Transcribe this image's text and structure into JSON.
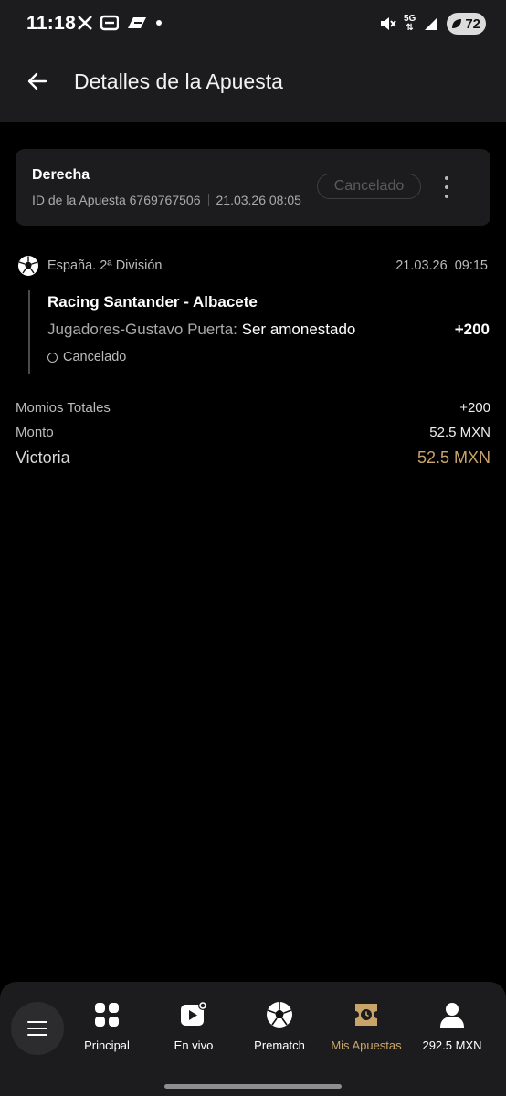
{
  "status_bar": {
    "time": "11:18",
    "network": "5G",
    "battery": "72",
    "colors": {
      "battery_bg": "#dcdcdc"
    }
  },
  "header": {
    "title": "Detalles de la Apuesta"
  },
  "bet": {
    "type": "Derecha",
    "id_label": "ID de la Apuesta 6769767506",
    "placed_at": "21.03.26 08:05",
    "status": "Cancelado"
  },
  "event": {
    "league": "España. 2ª División",
    "datetime": "21.03.26 09:15",
    "match": "Racing Santander - Albacete",
    "market": "Jugadores-Gustavo Puerta:",
    "selection": "Ser amonestado",
    "odd": "+200",
    "status": "Cancelado"
  },
  "summary": {
    "total_odds_label": "Momios Totales",
    "total_odds": "+200",
    "stake_label": "Monto",
    "stake": "52.5 MXN",
    "win_label": "Victoria",
    "win": "52.5 MXN"
  },
  "nav": {
    "items": [
      {
        "label": "Principal",
        "icon": "grid-icon"
      },
      {
        "label": "En vivo",
        "icon": "live-play-icon"
      },
      {
        "label": "Prematch",
        "icon": "soccer-ball-icon"
      },
      {
        "label": "Mis Apuestas",
        "icon": "ticket-clock-icon"
      },
      {
        "label": "292.5 MXN",
        "icon": "user-icon"
      }
    ]
  },
  "colors": {
    "accent": "#c9a46a",
    "surface": "#1c1c1e",
    "background": "#000000"
  }
}
